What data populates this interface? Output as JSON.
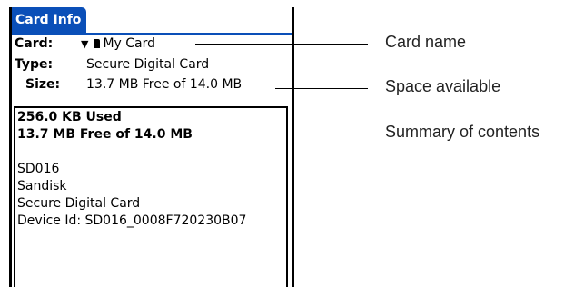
{
  "window": {
    "title": "Card Info"
  },
  "fields": {
    "card": {
      "label": "Card:",
      "value": "My Card"
    },
    "type": {
      "label": "Type:",
      "value": "Secure Digital Card"
    },
    "size": {
      "label": "Size:",
      "value": "13.7 MB Free of 14.0 MB"
    }
  },
  "contents": {
    "used": "256.0 KB Used",
    "free": "13.7 MB Free of 14.0 MB",
    "lines": [
      "SD016",
      "Sandisk",
      "Secure Digital Card",
      "Device Id: SD016_0008F720230B07"
    ]
  },
  "callouts": {
    "card_name": "Card name",
    "space_available": "Space available",
    "summary": "Summary of contents"
  },
  "colors": {
    "title_bar": "#0a4fb8"
  }
}
